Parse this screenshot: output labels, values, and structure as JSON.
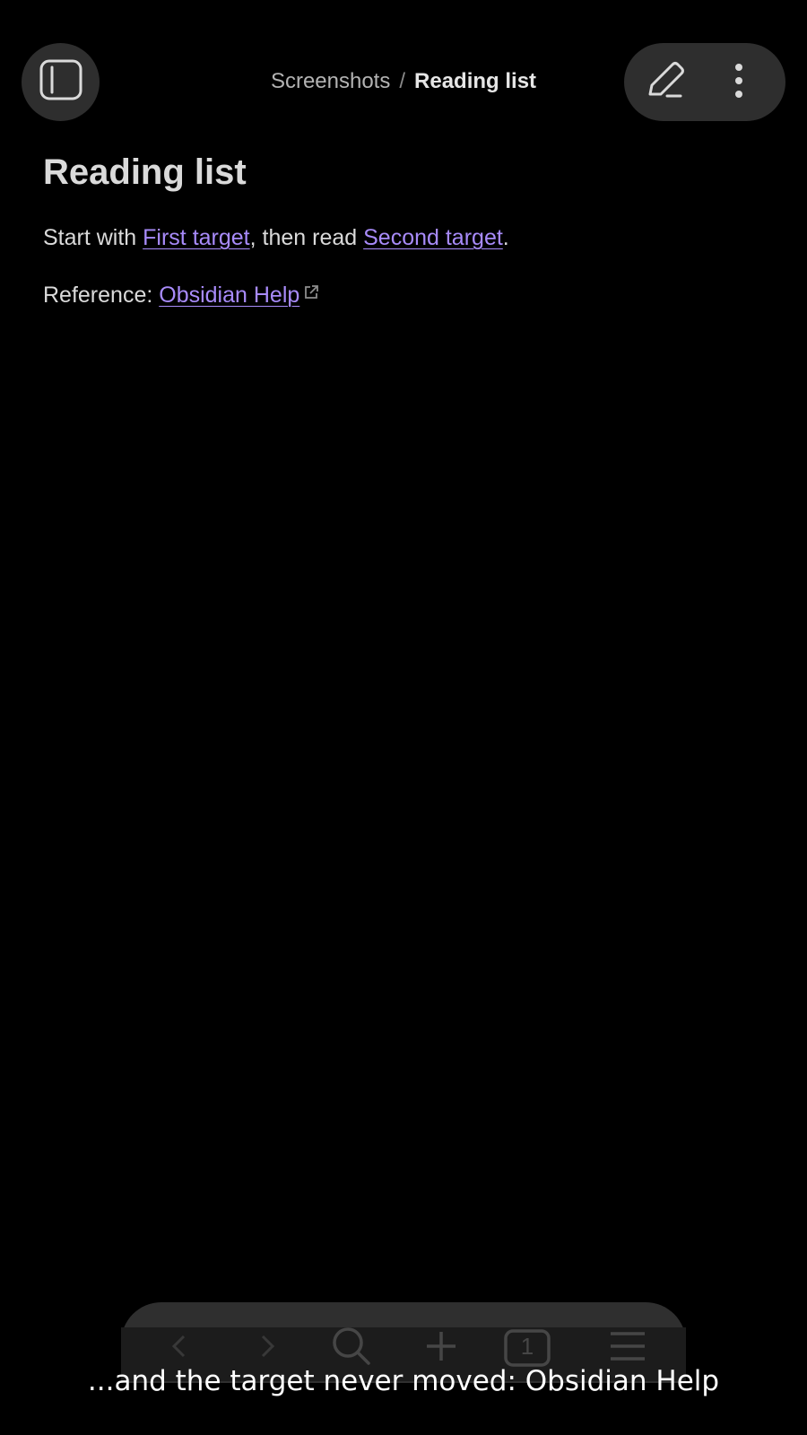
{
  "header": {
    "breadcrumb_parent": "Screenshots",
    "breadcrumb_separator": "/",
    "breadcrumb_current": "Reading list",
    "sidebar_toggle_icon": "sidebar-toggle-icon",
    "edit_icon": "pencil-icon",
    "more_icon": "more-vertical-icon"
  },
  "note": {
    "title": "Reading list",
    "line1": {
      "prefix": "Start with ",
      "link1": "First target",
      "middle": ", then read ",
      "link2": "Second target",
      "suffix": "."
    },
    "line2": {
      "prefix": "Reference: ",
      "link": "Obsidian Help",
      "link_icon": "external-link-icon"
    }
  },
  "bottom_toolbar": {
    "tab_count": "1",
    "icons": [
      "back-icon",
      "forward-icon",
      "search-icon",
      "plus-icon",
      "tabs-icon",
      "menu-icon"
    ]
  },
  "caption": "...and the target never moved: Obsidian Help",
  "colors": {
    "background": "#000000",
    "link": "#a88bfa",
    "pill": "#2e2e2e",
    "text": "#dadada"
  }
}
